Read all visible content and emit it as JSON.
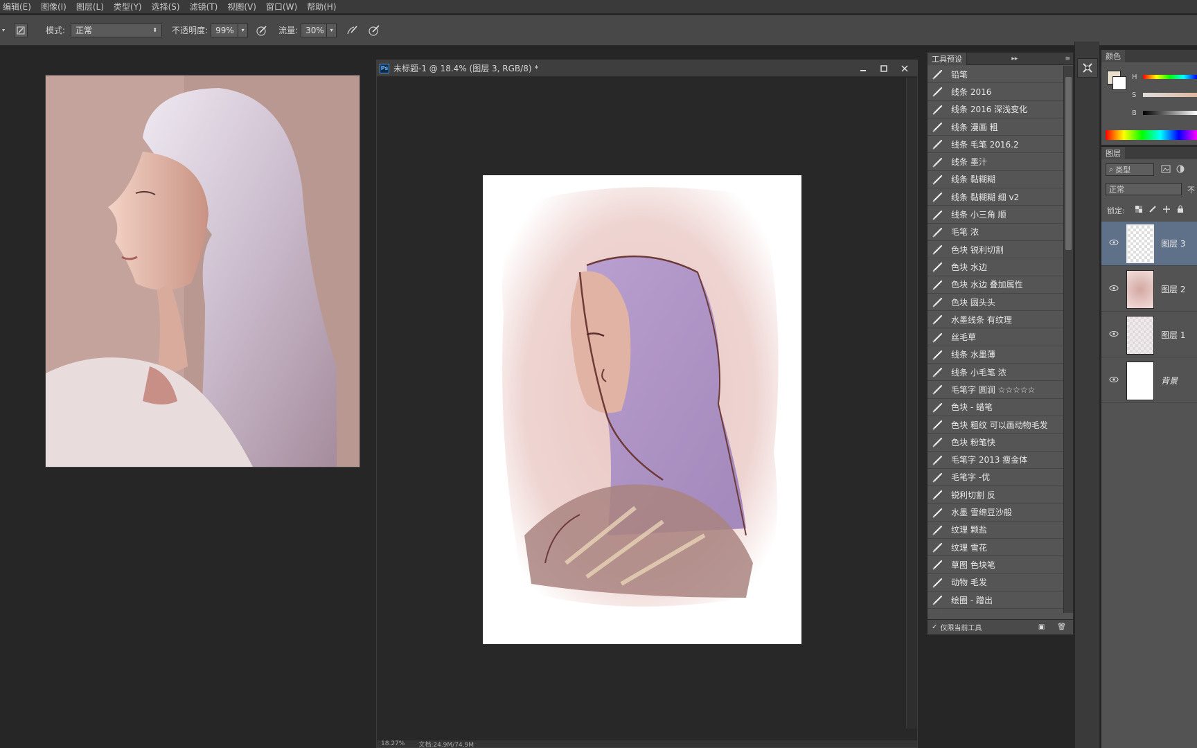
{
  "menu": [
    "编辑(E)",
    "图像(I)",
    "图层(L)",
    "类型(Y)",
    "选择(S)",
    "滤镜(T)",
    "视图(V)",
    "窗口(W)",
    "帮助(H)"
  ],
  "options": {
    "mode_label": "模式:",
    "mode_value": "正常",
    "opacity_label": "不透明度:",
    "opacity_value": "99%",
    "flow_label": "流量:",
    "flow_value": "30%"
  },
  "document": {
    "title": "未标题-1 @ 18.4% (图层 3, RGB/8) *",
    "ps_badge": "Ps",
    "status_zoom": "18.27%",
    "status_doc": "文档:24.9M/74.9M"
  },
  "tool_presets": {
    "tab": "工具预设",
    "items": [
      "铅笔",
      "线条 2016",
      "线条 2016 深浅变化",
      "线条 漫画 粗",
      "线条 毛笔 2016.2",
      "线条 墨汁",
      "线条 黏糊糊",
      "线条 黏糊糊 细 v2",
      "线条 小三角 顺",
      "毛笔 浓",
      "色块 锐利切割",
      "色块 水边",
      "色块 水边 叠加属性",
      "色块 圆头头",
      "水墨线条 有纹理",
      "丝毛草",
      "线条 水墨薄",
      "线条 小毛笔 浓",
      "毛笔字 圆润 ☆☆☆☆☆",
      "色块 - 蜡笔",
      "色块 粗纹 可以画动物毛发",
      "色块 粉笔快",
      "毛笔字 2013 瘦金体",
      "毛笔字 -优",
      "锐利切割 反",
      "水墨 雪绵豆沙般",
      "纹理 颗盐",
      "纹理 雪花",
      "草图 色块笔",
      "动物 毛发",
      "绘圈 - 蹭出",
      "绘圈 - 蹭出"
    ],
    "footer_label": "仅限当前工具"
  },
  "color_panel": {
    "tab": "颜色",
    "h": "H",
    "s": "S",
    "b": "B"
  },
  "layers_panel": {
    "tab": "图层",
    "filter": "类型",
    "blend": "正常",
    "opacity_short": "不",
    "lock_label": "锁定:",
    "layers": [
      "图层 3",
      "图层 2",
      "图层 1",
      "背景"
    ]
  }
}
